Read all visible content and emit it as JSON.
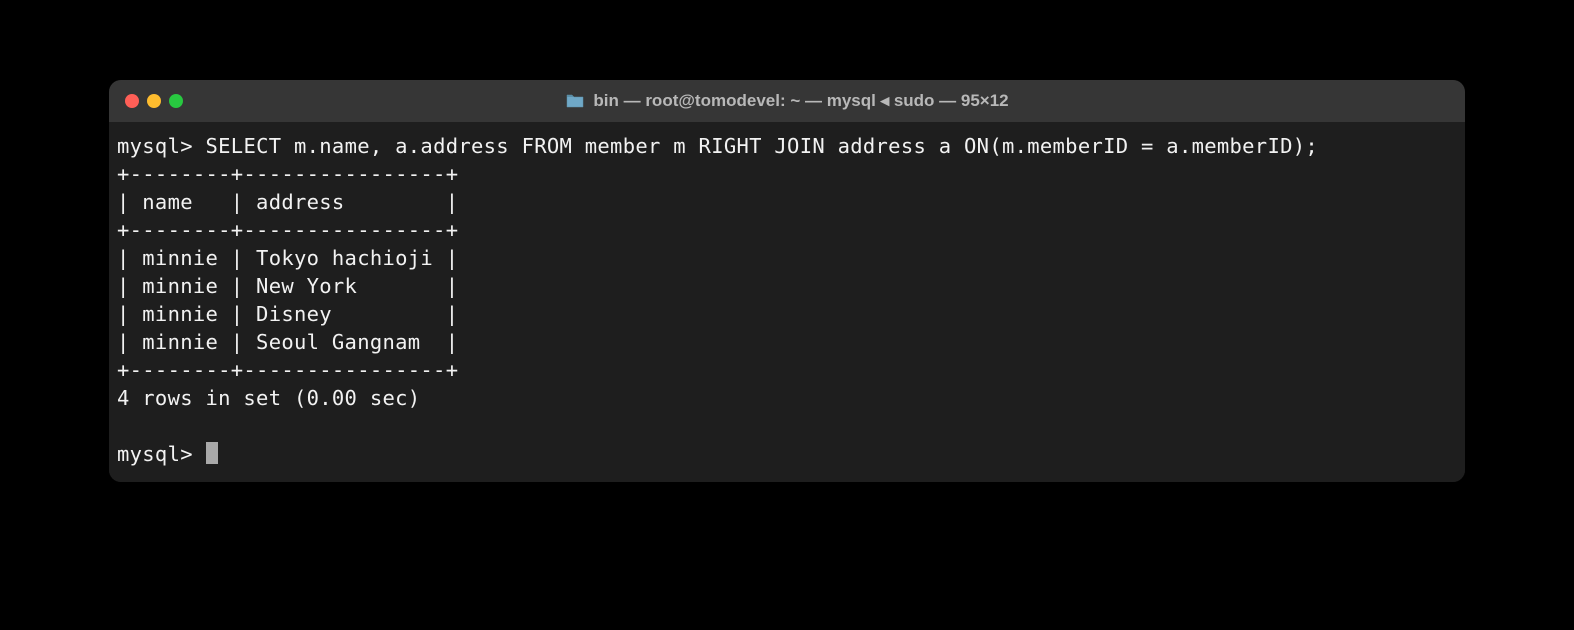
{
  "window": {
    "title": "bin — root@tomodevel: ~ — mysql ◂ sudo — 95×12",
    "folder_icon": "folder-icon"
  },
  "terminal": {
    "prompt": "mysql>",
    "query": "SELECT m.name, a.address FROM member m RIGHT JOIN address a ON(m.memberID = a.memberID);",
    "table": {
      "border_top": "+--------+----------------+",
      "header_row": "| name   | address        |",
      "border_mid": "+--------+----------------+",
      "rows": [
        "| minnie | Tokyo hachioji |",
        "| minnie | New York       |",
        "| minnie | Disney         |",
        "| minnie | Seoul Gangnam  |"
      ],
      "border_bottom": "+--------+----------------+"
    },
    "status": "4 rows in set (0.00 sec)",
    "prompt2": "mysql> "
  }
}
